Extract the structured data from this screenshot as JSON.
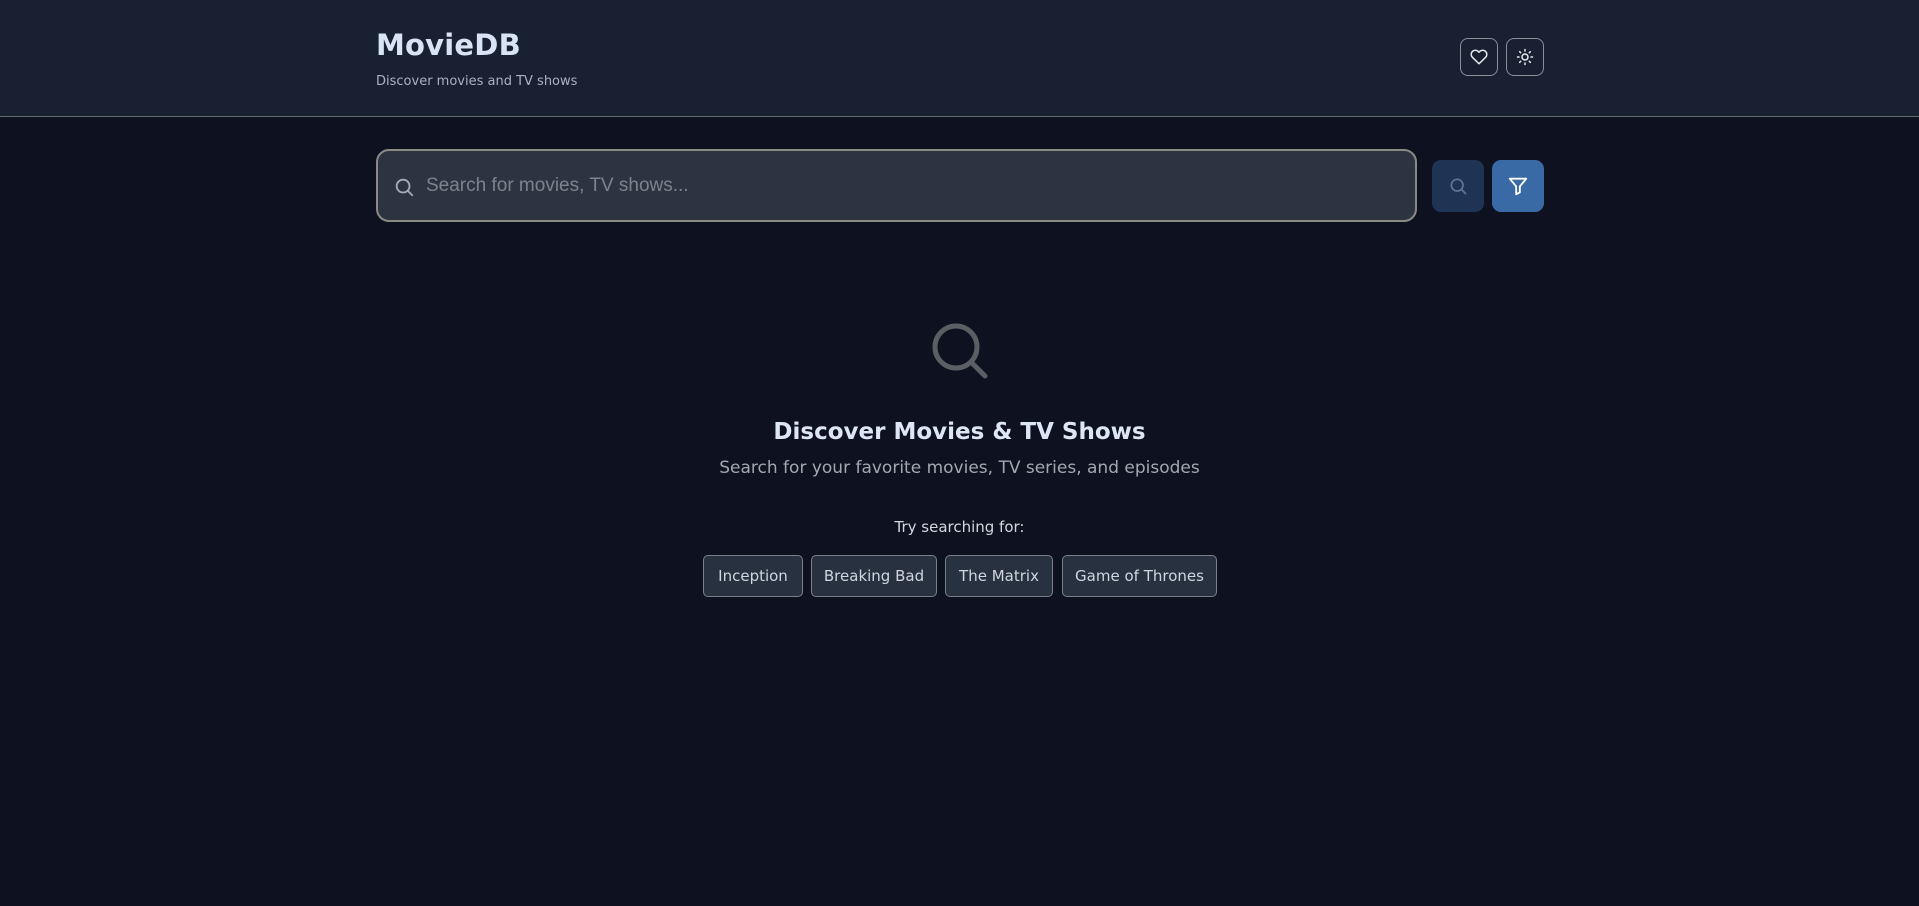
{
  "header": {
    "title": "MovieDB",
    "subtitle": "Discover movies and TV shows",
    "favorites_icon": "heart-icon",
    "theme_icon": "sun-icon"
  },
  "search": {
    "placeholder": "Search for movies, TV shows...",
    "value": "",
    "search_icon": "search-icon",
    "filter_icon": "filter-icon"
  },
  "empty_state": {
    "icon": "search-icon",
    "title": "Discover Movies & TV Shows",
    "subtitle": "Search for your favorite movies, TV series, and episodes",
    "try_label": "Try searching for:",
    "suggestions": [
      "Inception",
      "Breaking Bad",
      "The Matrix",
      "Game of Thrones"
    ]
  },
  "colors": {
    "background": "#0d1120",
    "header_background": "#182032",
    "accent": "#3a6aa6",
    "text_primary": "#dce6f5"
  }
}
